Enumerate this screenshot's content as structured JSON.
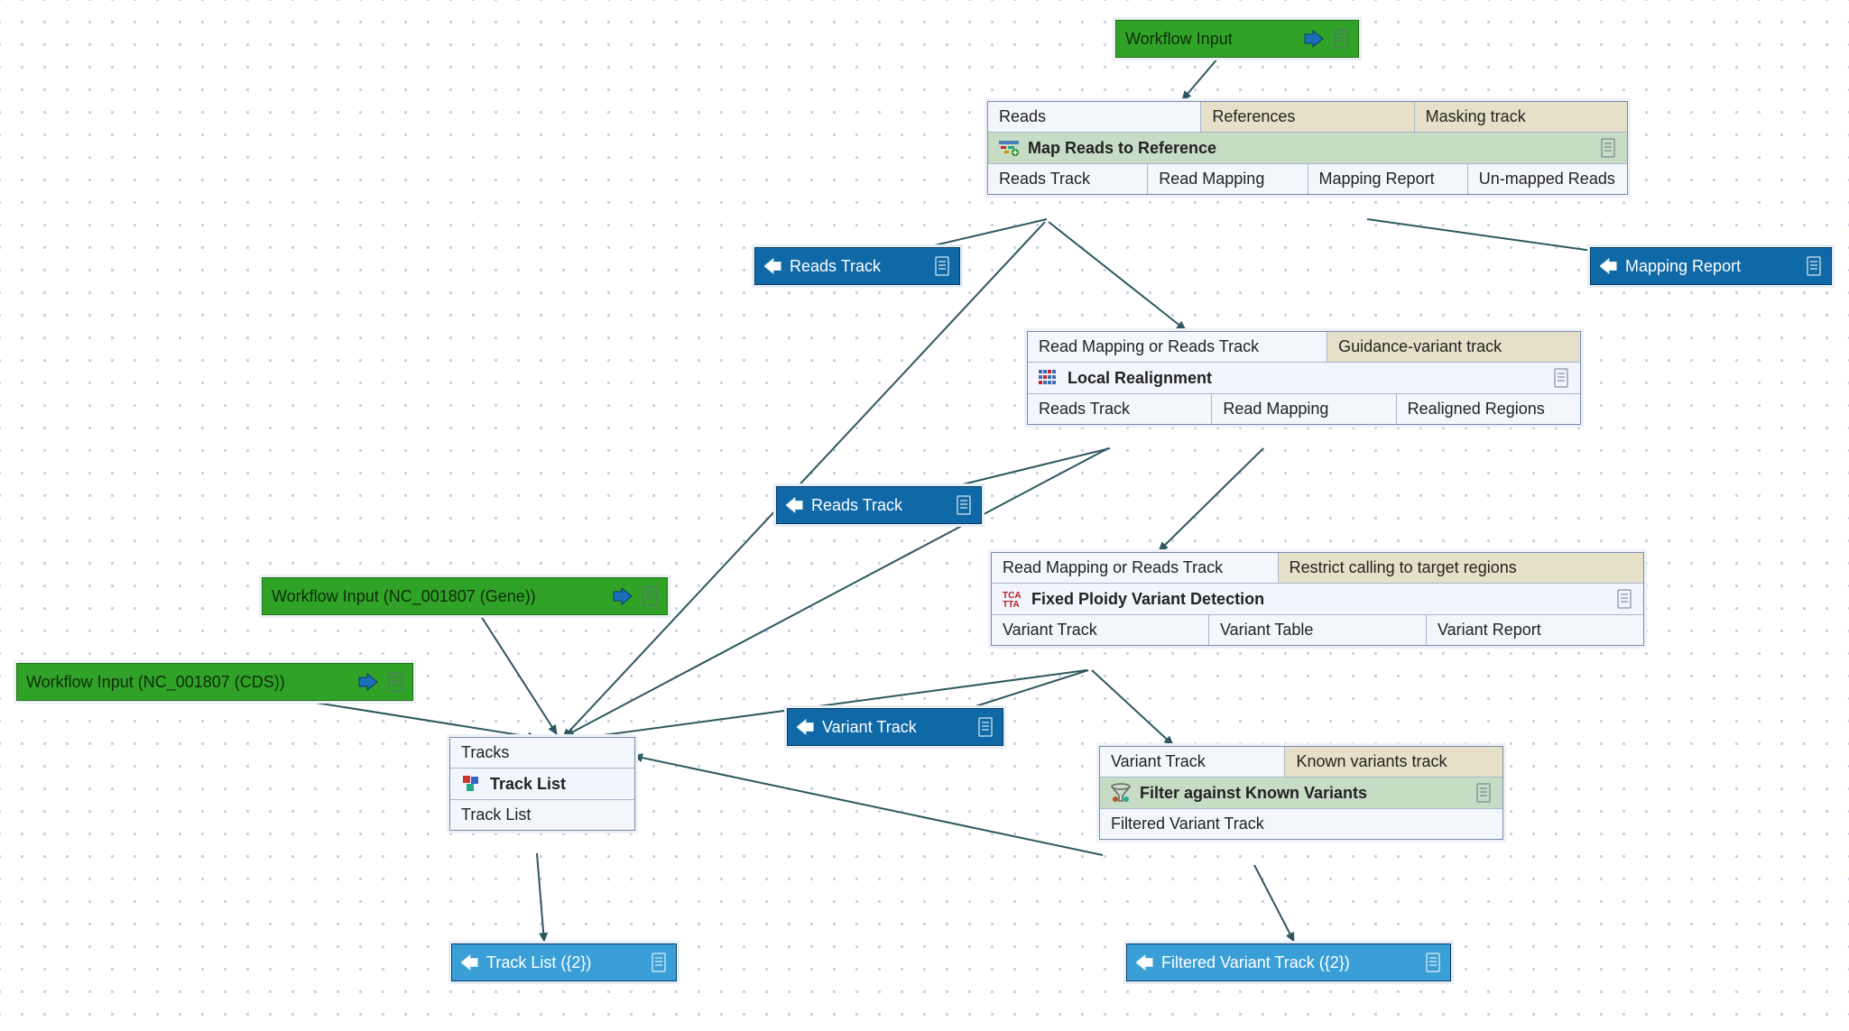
{
  "inputs": {
    "wf_main": "Workflow Input",
    "wf_gene": "Workflow Input (NC_001807 (Gene))",
    "wf_cds": "Workflow Input (NC_001807 (CDS))"
  },
  "outputs": {
    "reads_track_1": "Reads Track",
    "mapping_report": "Mapping Report",
    "reads_track_2": "Reads Track",
    "variant_track": "Variant Track",
    "track_list": "Track List ({2})",
    "filtered_variant_track": "Filtered Variant Track ({2})"
  },
  "tools": {
    "map_reads": {
      "title": "Map Reads to Reference",
      "inputs": [
        "Reads",
        "References",
        "Masking track"
      ],
      "outputs": [
        "Reads Track",
        "Read Mapping",
        "Mapping Report",
        "Un-mapped Reads"
      ]
    },
    "local_realign": {
      "title": "Local Realignment",
      "inputs": [
        "Read Mapping or Reads Track",
        "Guidance-variant track"
      ],
      "outputs": [
        "Reads Track",
        "Read Mapping",
        "Realigned Regions"
      ]
    },
    "fixed_ploidy": {
      "title": "Fixed Ploidy Variant Detection",
      "inputs": [
        "Read Mapping or Reads Track",
        "Restrict calling to target regions"
      ],
      "outputs": [
        "Variant Track",
        "Variant Table",
        "Variant Report"
      ]
    },
    "track_list": {
      "title": "Track List",
      "inputs": [
        "Tracks"
      ],
      "outputs": [
        "Track List"
      ]
    },
    "filter_known": {
      "title": "Filter against Known Variants",
      "inputs": [
        "Variant Track",
        "Known variants track"
      ],
      "outputs": [
        "Filtered Variant Track"
      ]
    }
  },
  "colors": {
    "input_bg": "#31a228",
    "output_dark": "#0f69a7",
    "output_light": "#3a9fd6",
    "tool_title_green": "#c7dcc5",
    "muted_cell": "#e6e0c8",
    "edge": "#2f5760"
  }
}
